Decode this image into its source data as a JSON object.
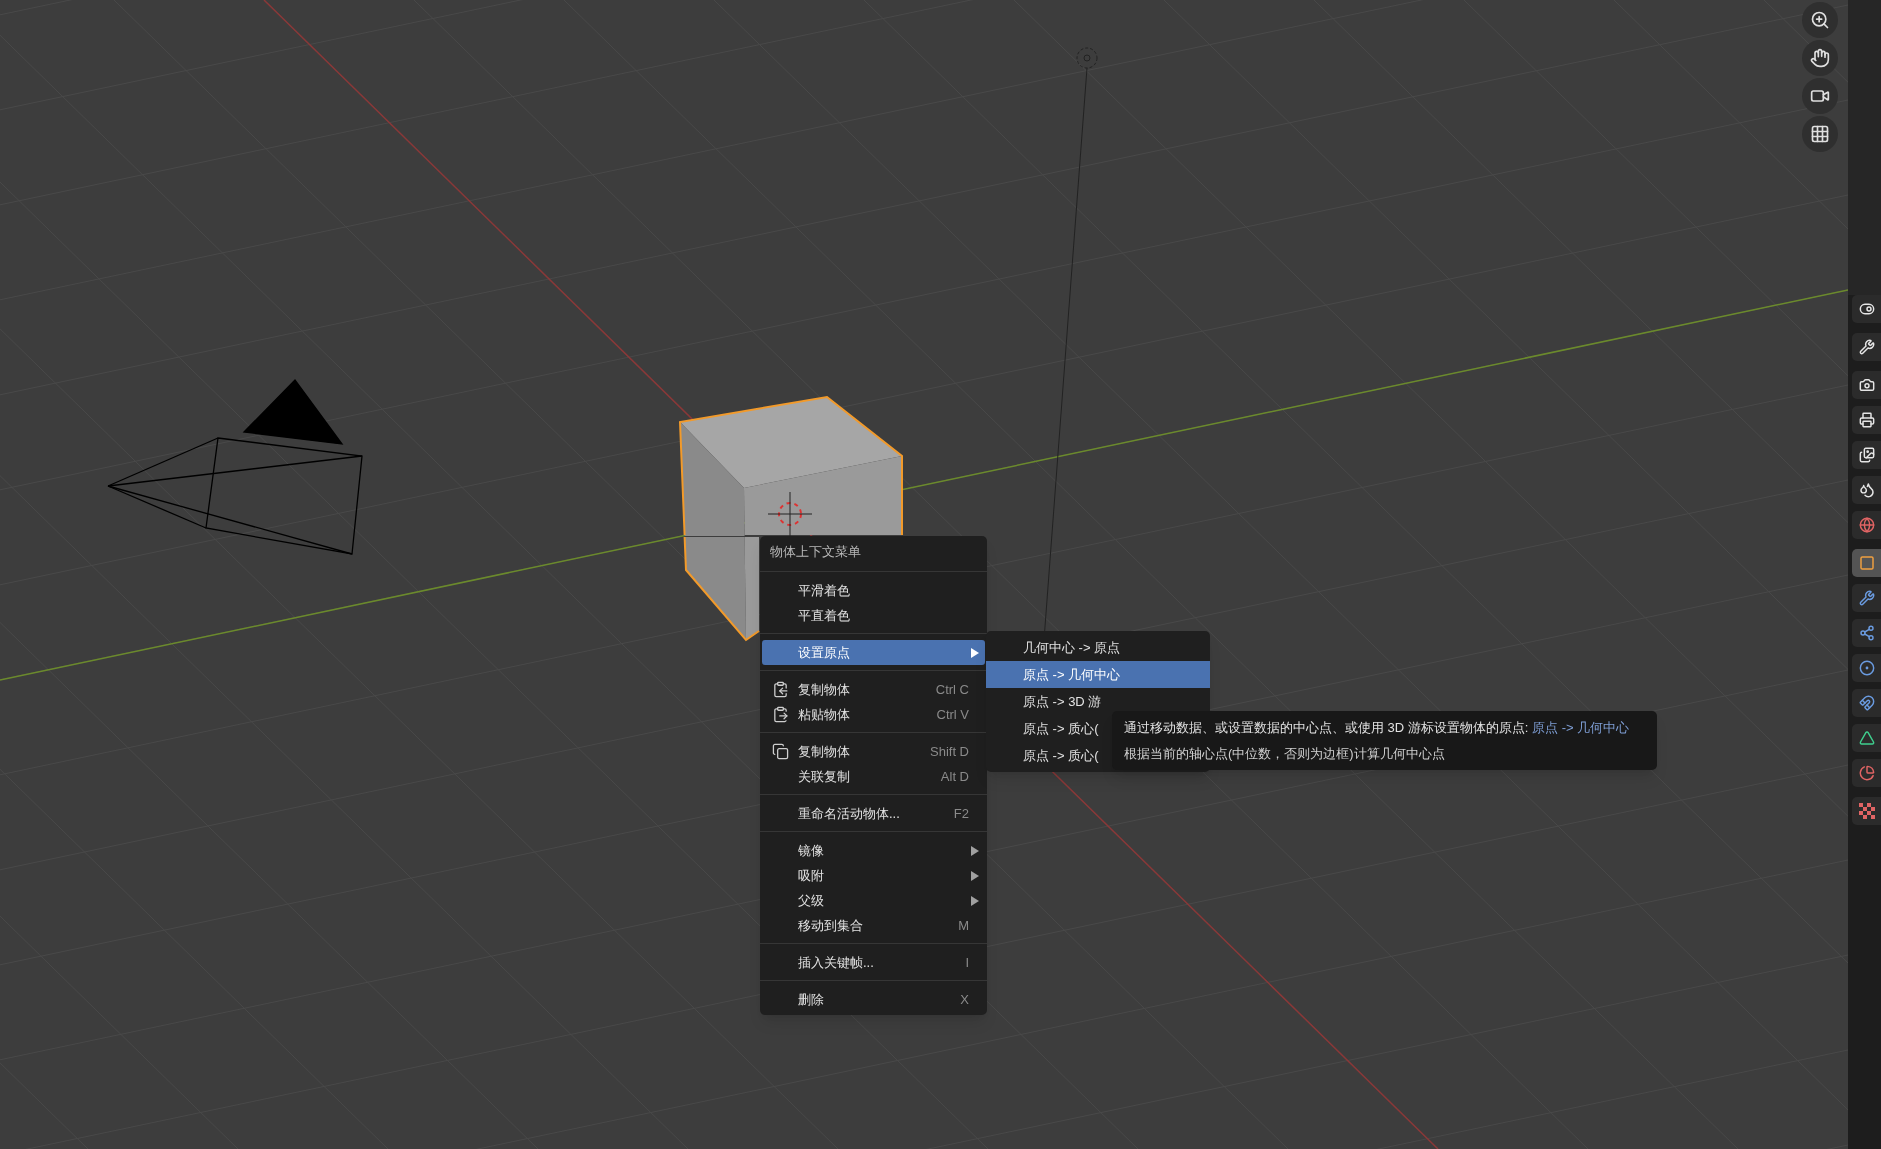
{
  "viewport": {
    "navigation": [
      {
        "kind": "zoom"
      },
      {
        "kind": "pan"
      },
      {
        "kind": "camera"
      },
      {
        "kind": "perspective"
      }
    ]
  },
  "context_menu": {
    "title": "物体上下文菜单",
    "sections": [
      [
        {
          "kind": "plain",
          "label": "平滑着色",
          "submenu": false,
          "selected": false
        },
        {
          "kind": "plain",
          "label": "平直着色",
          "submenu": false,
          "selected": false
        }
      ],
      [
        {
          "kind": "plain",
          "label": "设置原点",
          "submenu": true,
          "selected": true
        }
      ],
      [
        {
          "kind": "copy",
          "label": "复制物体",
          "shortcut": "Ctrl C",
          "submenu": false,
          "selected": false
        },
        {
          "kind": "paste",
          "label": "粘贴物体",
          "shortcut": "Ctrl V",
          "submenu": false,
          "selected": false
        }
      ],
      [
        {
          "kind": "duplicate",
          "label": "复制物体",
          "shortcut": "Shift D",
          "submenu": false,
          "selected": false
        },
        {
          "kind": "plain",
          "label": "关联复制",
          "shortcut": "Alt D",
          "submenu": false,
          "selected": false
        }
      ],
      [
        {
          "kind": "plain",
          "label": "重命名活动物体...",
          "shortcut": "F2",
          "submenu": false,
          "selected": false
        }
      ],
      [
        {
          "kind": "plain",
          "label": "镜像",
          "submenu": true,
          "selected": false
        },
        {
          "kind": "plain",
          "label": "吸附",
          "submenu": true,
          "selected": false
        },
        {
          "kind": "plain",
          "label": "父级",
          "submenu": true,
          "selected": false
        },
        {
          "kind": "plain",
          "label": "移动到集合",
          "shortcut": "M",
          "submenu": false,
          "selected": false
        }
      ],
      [
        {
          "kind": "plain",
          "label": "插入关键帧...",
          "shortcut": "I",
          "submenu": false,
          "selected": false
        }
      ],
      [
        {
          "kind": "plain",
          "label": "删除",
          "shortcut": "X",
          "submenu": false,
          "selected": false
        }
      ]
    ]
  },
  "submenu": {
    "items": [
      {
        "label": "几何中心 -> 原点",
        "selected": false
      },
      {
        "label": "原点 -> 几何中心",
        "selected": true
      },
      {
        "label": "原点 -> 3D 游",
        "selected": false
      },
      {
        "label": "原点 -> 质心(",
        "selected": false
      },
      {
        "label": "原点 -> 质心(",
        "selected": false
      }
    ]
  },
  "tooltip": {
    "description": "通过移动数据、或设置数据的中心点、或使用 3D 游标设置物体的原点: ",
    "operator": "原点 -> 几何中心",
    "detail": "根据当前的轴心点(中位数，否则为边框)计算几何中心点"
  },
  "properties": {
    "tab_groups": [
      [
        {
          "kind": "toggle",
          "selected": false
        }
      ],
      [
        {
          "kind": "tool",
          "selected": false
        }
      ],
      [
        {
          "kind": "render",
          "selected": false
        },
        {
          "kind": "output",
          "selected": false
        },
        {
          "kind": "view_layer",
          "selected": false
        },
        {
          "kind": "scene",
          "selected": false
        },
        {
          "kind": "world",
          "selected": false
        }
      ],
      [
        {
          "kind": "object",
          "selected": true
        },
        {
          "kind": "modifiers",
          "selected": false
        },
        {
          "kind": "particles",
          "selected": false
        },
        {
          "kind": "physics",
          "selected": false
        },
        {
          "kind": "constraints",
          "selected": false
        },
        {
          "kind": "data",
          "selected": false
        },
        {
          "kind": "material",
          "selected": false
        }
      ],
      [
        {
          "kind": "texture",
          "selected": false
        }
      ]
    ]
  }
}
